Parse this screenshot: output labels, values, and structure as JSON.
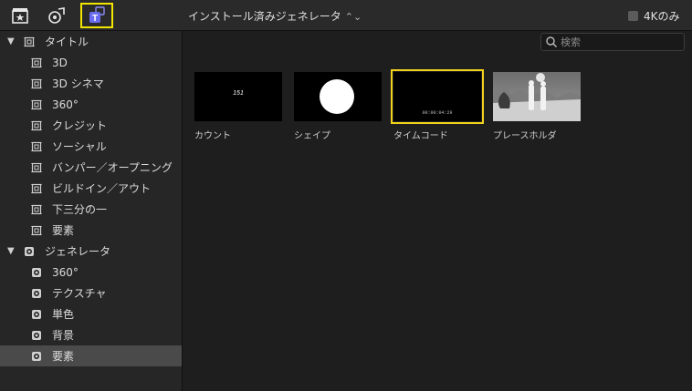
{
  "toolbar": {
    "title": "インストール済みジェネレータ",
    "title_chevron": "⌃⌄",
    "fourk_label": "4Kのみ",
    "icons": [
      "photos-icon",
      "music-icon",
      "titles-generators-icon"
    ]
  },
  "search": {
    "placeholder": "検索"
  },
  "sidebar": {
    "titles_group": {
      "label": "タイトル",
      "items": [
        "3D",
        "3D シネマ",
        "360°",
        "クレジット",
        "ソーシャル",
        "バンパー／オープニング",
        "ビルドイン／アウト",
        "下三分の一",
        "要素"
      ]
    },
    "generators_group": {
      "label": "ジェネレータ",
      "items": [
        "360°",
        "テクスチャ",
        "単色",
        "背景",
        "要素"
      ],
      "selected_index": 4
    }
  },
  "thumbnails": [
    {
      "label": "カウント",
      "overlay": "151"
    },
    {
      "label": "シェイプ",
      "overlay": ""
    },
    {
      "label": "タイムコード",
      "overlay": "00:00:04:29"
    },
    {
      "label": "プレースホルダ",
      "overlay": ""
    }
  ],
  "colors": {
    "selection": "#f2e600",
    "thumb_selection": "#f2d21b",
    "accent": "#6a6cf0"
  }
}
